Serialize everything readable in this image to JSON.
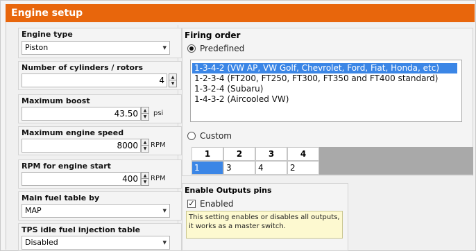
{
  "title": "Engine setup",
  "left": {
    "engine_type": {
      "label": "Engine type",
      "value": "Piston"
    },
    "cylinders": {
      "label": "Number of cylinders / rotors",
      "value": "4"
    },
    "max_boost": {
      "label": "Maximum boost",
      "value": "43.50",
      "unit": "psi"
    },
    "max_speed": {
      "label": "Maximum engine speed",
      "value": "8000",
      "unit": "RPM"
    },
    "rpm_start": {
      "label": "RPM for engine start",
      "value": "400",
      "unit": "RPM"
    },
    "fuel_table": {
      "label": "Main fuel table by",
      "value": "MAP"
    },
    "tps_idle": {
      "label": "TPS idle fuel injection table",
      "value": "Disabled"
    }
  },
  "firing": {
    "title": "Firing order",
    "predefined_label": "Predefined",
    "custom_label": "Custom",
    "options": [
      "1-3-4-2 (VW AP, VW Golf, Chevrolet, Ford, Fiat, Honda, etc)",
      "1-2-3-4 (FT200, FT250, FT300, FT350 and FT400 standard)",
      "1-3-2-4 (Subaru)",
      "1-4-3-2 (Aircooled VW)"
    ],
    "selected_index": 0,
    "grid_headers": [
      "1",
      "2",
      "3",
      "4"
    ],
    "grid_values": [
      "1",
      "3",
      "4",
      "2"
    ]
  },
  "outputs": {
    "title": "Enable Outputs pins",
    "checkbox_label": "Enabled",
    "checked": true,
    "note": "This setting enables or disables all outputs, it works as a master switch."
  },
  "icons": {
    "chevron": "▾",
    "spin_up": "▲",
    "spin_down": "▼",
    "check": "✓"
  }
}
